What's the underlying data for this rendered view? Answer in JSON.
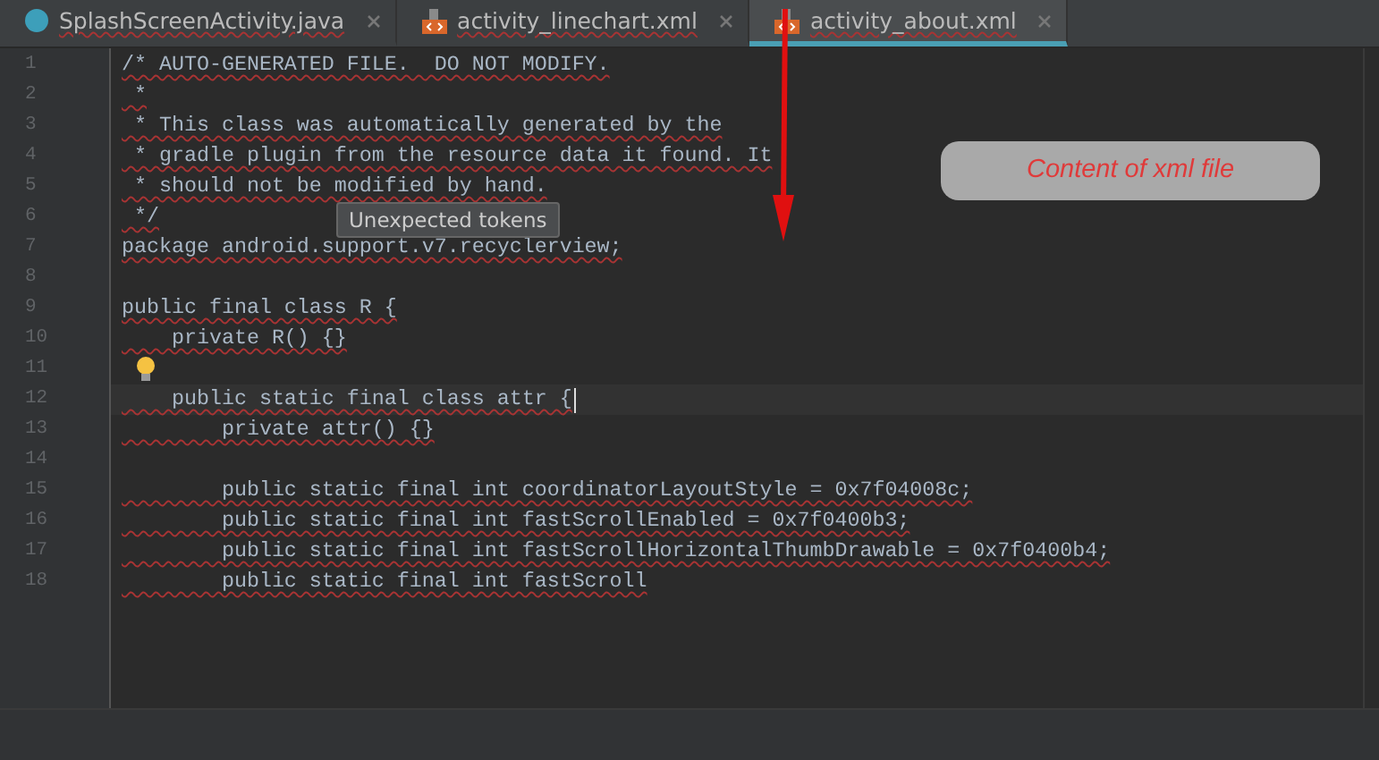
{
  "tabs": [
    {
      "label": "SplashScreenActivity.java",
      "kind": "java",
      "selected": false
    },
    {
      "label": "activity_linechart.xml",
      "kind": "xml",
      "selected": false
    },
    {
      "label": "activity_about.xml",
      "kind": "xml",
      "selected": true
    }
  ],
  "lines": [
    {
      "number": "1",
      "text": "/* AUTO-GENERATED FILE.  DO NOT MODIFY.",
      "current": false,
      "bulb": false
    },
    {
      "number": "2",
      "text": " *",
      "current": false,
      "bulb": false
    },
    {
      "number": "3",
      "text": " * This class was automatically generated by the",
      "current": false,
      "bulb": false
    },
    {
      "number": "4",
      "text": " * gradle plugin from the resource data it found. It",
      "current": false,
      "bulb": false
    },
    {
      "number": "5",
      "text": " * should not be modified by hand.",
      "current": false,
      "bulb": false
    },
    {
      "number": "6",
      "text": " */",
      "current": false,
      "bulb": false
    },
    {
      "number": "7",
      "text": "package android.support.v7.recyclerview;",
      "current": false,
      "bulb": false
    },
    {
      "number": "8",
      "current": false,
      "bulb": false
    },
    {
      "number": "9",
      "text": "public final class R {",
      "current": false,
      "bulb": false
    },
    {
      "number": "10",
      "text": "    private R() {}",
      "current": false,
      "bulb": false
    },
    {
      "number": "11",
      "current": false,
      "bulb": true
    },
    {
      "number": "12",
      "text": "    public static final class attr {",
      "current": true,
      "bulb": false
    },
    {
      "number": "13",
      "text": "        private attr() {}",
      "current": false,
      "bulb": false
    },
    {
      "number": "14",
      "current": false,
      "bulb": false
    },
    {
      "number": "15",
      "text": "        public static final int coordinatorLayoutStyle = 0x7f04008c;",
      "current": false,
      "bulb": false
    },
    {
      "number": "16",
      "text": "        public static final int fastScrollEnabled = 0x7f0400b3;",
      "current": false,
      "bulb": false
    },
    {
      "number": "17",
      "text": "        public static final int fastScrollHorizontalThumbDrawable = 0x7f0400b4;",
      "current": false,
      "bulb": false
    },
    {
      "number": "18",
      "text": "        public static final int fastScroll",
      "current": false,
      "bulb": false
    }
  ],
  "tooltip": "Unexpected tokens",
  "annotation": "Content of xml file"
}
